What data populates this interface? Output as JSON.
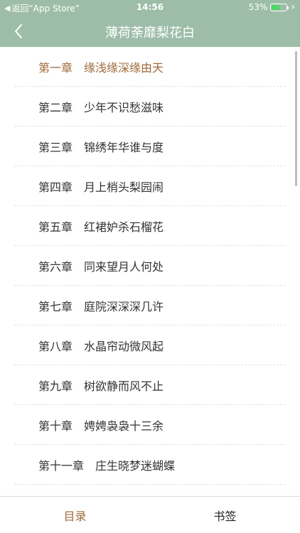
{
  "status_bar": {
    "back_label": "返回“App Store”",
    "time": "14:56",
    "battery_percent": "53%",
    "battery_level": 0.53
  },
  "nav": {
    "title": "薄荷荼靡梨花白",
    "back_icon": "chevron-left-icon"
  },
  "chapters": [
    {
      "num": "第一章",
      "title": "缘浅缘深缘由天",
      "current": true
    },
    {
      "num": "第二章",
      "title": "少年不识愁滋味"
    },
    {
      "num": "第三章",
      "title": "锦绣年华谁与度"
    },
    {
      "num": "第四章",
      "title": "月上梢头梨园闹"
    },
    {
      "num": "第五章",
      "title": "红裙妒杀石榴花"
    },
    {
      "num": "第六章",
      "title": "同来望月人何处"
    },
    {
      "num": "第七章",
      "title": "庭院深深深几许"
    },
    {
      "num": "第八章",
      "title": "水晶帘动微风起"
    },
    {
      "num": "第九章",
      "title": "树欲静而风不止"
    },
    {
      "num": "第十章",
      "title": "娉娉袅袅十三余"
    },
    {
      "num": "第十一章",
      "title": "庄生晓梦迷蝴蝶"
    }
  ],
  "tabs": {
    "toc": "目录",
    "bookmark": "书签"
  },
  "colors": {
    "header_bg": "#9dbda8",
    "accent": "#a06b3a"
  }
}
